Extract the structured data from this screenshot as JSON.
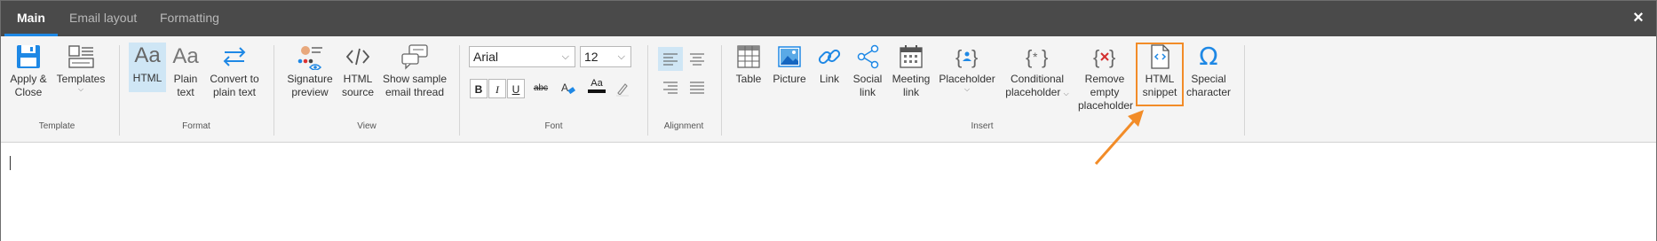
{
  "tabs": [
    {
      "label": "Main"
    },
    {
      "label": "Email layout"
    },
    {
      "label": "Formatting"
    }
  ],
  "close_icon": "×",
  "groups": {
    "template": "Template",
    "format": "Format",
    "view": "View",
    "font": "Font",
    "alignment": "Alignment",
    "insert": "Insert"
  },
  "buttons": {
    "apply_close": [
      "Apply &",
      "Close"
    ],
    "templates": [
      "Templates"
    ],
    "html": [
      "HTML"
    ],
    "plain_text": [
      "Plain",
      "text"
    ],
    "convert": [
      "Convert to",
      "plain text"
    ],
    "signature_preview": [
      "Signature",
      "preview"
    ],
    "html_source": [
      "HTML",
      "source"
    ],
    "sample_thread": [
      "Show sample",
      "email thread"
    ],
    "table": [
      "Table"
    ],
    "picture": [
      "Picture"
    ],
    "link": [
      "Link"
    ],
    "social_link": [
      "Social",
      "link"
    ],
    "meeting_link": [
      "Meeting",
      "link"
    ],
    "placeholder": [
      "Placeholder"
    ],
    "conditional_placeholder": [
      "Conditional",
      "placeholder"
    ],
    "remove_empty": [
      "Remove",
      "empty",
      "placeholder"
    ],
    "html_snippet": [
      "HTML",
      "snippet"
    ],
    "special_character": [
      "Special",
      "character"
    ]
  },
  "font": {
    "family": "Arial",
    "size": "12",
    "bold": "B",
    "italic": "I",
    "underline": "U",
    "strike": "abc",
    "clear_format": "A",
    "font_color": "Aa"
  },
  "colors": {
    "accent": "#1e88e5",
    "highlight": "#f28c28",
    "titlebar": "#4a4a4a",
    "ribbon": "#f4f4f4"
  }
}
